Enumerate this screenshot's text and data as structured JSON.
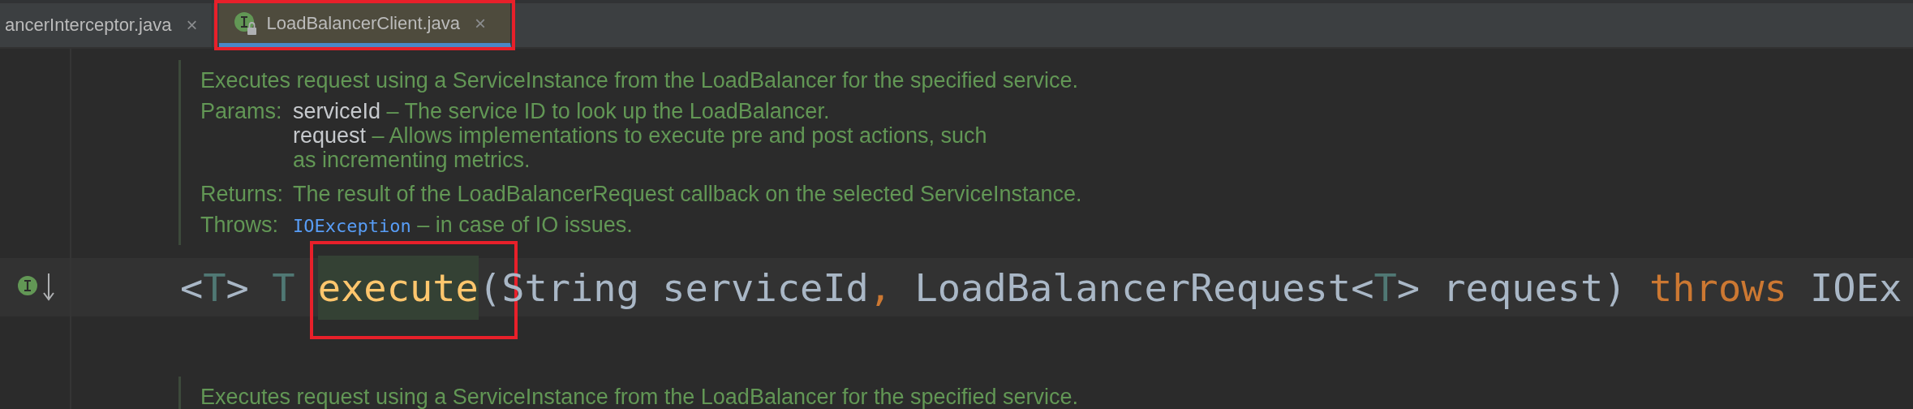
{
  "tabs": [
    {
      "label": "ancerInterceptor.java",
      "close": "×",
      "selected": false,
      "kind": "plain",
      "highlighted": false
    },
    {
      "label": "LoadBalancerClient.java",
      "close": "×",
      "selected": true,
      "kind": "interface",
      "highlighted": true
    }
  ],
  "doc_comments": [
    {
      "summary": "Executes request using a ServiceInstance from the LoadBalancer for the specified service.",
      "params_label": "Params:",
      "params": [
        {
          "name": "serviceId",
          "description": "– The service ID to look up the LoadBalancer."
        },
        {
          "name": "request",
          "description": "– Allows implementations to execute pre and post actions, such as incrementing metrics."
        }
      ],
      "returns_label": "Returns:",
      "returns": "The result of the LoadBalancerRequest callback on the selected ServiceInstance.",
      "throws_label": "Throws:",
      "throws": [
        {
          "name": "IOException",
          "description": "– in case of IO issues."
        }
      ]
    },
    {
      "summary": "Executes request using a ServiceInstance from the LoadBalancer for the specified service."
    }
  ],
  "code_line": {
    "tokens": [
      {
        "text": "<",
        "kind": "plain",
        "highlighted": false
      },
      {
        "text": "T",
        "kind": "type-param",
        "highlighted": false
      },
      {
        "text": "> ",
        "kind": "plain",
        "highlighted": false
      },
      {
        "text": "T ",
        "kind": "type-param",
        "highlighted": false
      },
      {
        "text": "execute",
        "kind": "method",
        "highlighted": true
      },
      {
        "text": "(String serviceId",
        "kind": "plain",
        "highlighted": false
      },
      {
        "text": ", ",
        "kind": "comma",
        "highlighted": false
      },
      {
        "text": "LoadBalancerRequest<",
        "kind": "plain",
        "highlighted": false
      },
      {
        "text": "T",
        "kind": "type-param",
        "highlighted": false
      },
      {
        "text": "> request) ",
        "kind": "plain",
        "highlighted": false
      },
      {
        "text": "throws ",
        "kind": "keyword",
        "highlighted": false
      },
      {
        "text": "IOEx",
        "kind": "plain",
        "highlighted": false
      }
    ]
  }
}
